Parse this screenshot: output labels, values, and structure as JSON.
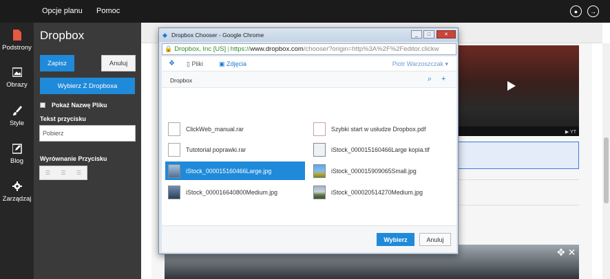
{
  "topbar": {
    "menu": [
      "Opcje planu",
      "Pomoc"
    ],
    "icons": [
      "user-icon",
      "logout-icon"
    ]
  },
  "leftnav": {
    "items": [
      {
        "label": "Podstrony",
        "icon": "page-icon"
      },
      {
        "label": "Obrazy",
        "icon": "image-icon"
      },
      {
        "label": "Style",
        "icon": "brush-icon"
      },
      {
        "label": "Blog",
        "icon": "edit-icon"
      },
      {
        "label": "Zarządzaj",
        "icon": "gear-icon"
      }
    ]
  },
  "panel": {
    "title": "Dropbox",
    "save_label": "Zapisz",
    "cancel_label": "Anuluj",
    "choose_label": "Wybierz Z Dropboxa",
    "show_name_label": "Pokaż Nazwę Pliku",
    "show_name_checked": false,
    "button_text_label": "Tekst przycisku",
    "button_text_value": "Pobierz",
    "alignment_label": "Wyrównanie Przycisku"
  },
  "dialog": {
    "title": "Dropbox Chooser - Google Chrome",
    "url_org": "Dropbox, Inc [US]",
    "url_proto": "https://",
    "url_host": "www.dropbox.com",
    "url_path": "/chooser?origin=http%3A%2F%2Feditor.clickw",
    "tabs": [
      "Pliki",
      "Zdjęcia"
    ],
    "user": "Piotr Warzoszczak",
    "breadcrumb": "Dropbox",
    "files_left": [
      {
        "name": "ClickWeb_manual.rar",
        "type": "doc",
        "selected": false
      },
      {
        "name": "Tutotorial poprawki.rar",
        "type": "doc",
        "selected": false
      },
      {
        "name": "iStock_000015160466Large.jpg",
        "type": "thumb",
        "selected": true
      },
      {
        "name": "iStock_000016640800Medium.jpg",
        "type": "thumb",
        "selected": false
      }
    ],
    "files_right": [
      {
        "name": "Szybki start w usłudze Dropbox.pdf",
        "type": "pdf",
        "selected": false
      },
      {
        "name": "iStock_000015160466Large kopia.tif",
        "type": "img",
        "selected": false
      },
      {
        "name": "iStock_000015909065Small.jpg",
        "type": "thumb",
        "selected": false
      },
      {
        "name": "iStock_000020514270Medium.jpg",
        "type": "thumb",
        "selected": false
      }
    ],
    "ok_label": "Wybierz",
    "cancel_label": "Anuluj"
  },
  "colors": {
    "accent": "#1f8ad9",
    "sidebar": "#262626",
    "panel": "#3a3a3a"
  }
}
